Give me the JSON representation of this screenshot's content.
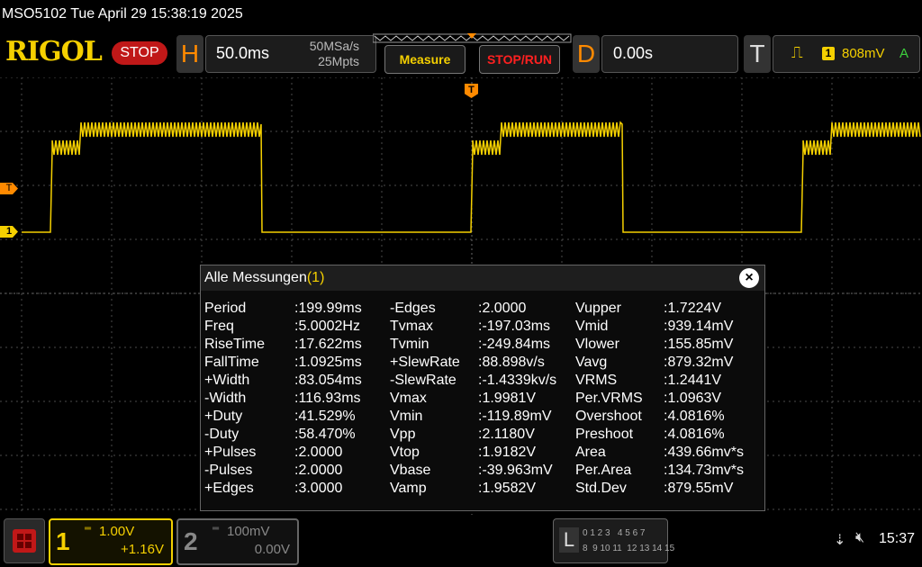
{
  "title": "MSO5102  Tue April 29 15:38:19 2025",
  "logo": "RIGOL",
  "run_state": "STOP",
  "horizontal": {
    "letter": "H",
    "timebase": "50.0ms",
    "sample_rate": "50MSa/s",
    "memory": "25Mpts"
  },
  "buttons": {
    "measure": "Measure",
    "stop_run": "STOP/RUN"
  },
  "delay": {
    "letter": "D",
    "value": "0.00s"
  },
  "trigger": {
    "letter": "T",
    "source": "1",
    "level": "808mV",
    "mode": "A"
  },
  "markers": {
    "trigger": "T",
    "ch1": "1",
    "top_trigger": "T"
  },
  "dialog": {
    "title": "Alle Messungen",
    "count": "(1)",
    "col1": [
      {
        "name": "Period",
        "value": ":199.99ms"
      },
      {
        "name": "Freq",
        "value": ":5.0002Hz"
      },
      {
        "name": "RiseTime",
        "value": ":17.622ms"
      },
      {
        "name": "FallTime",
        "value": ":1.0925ms"
      },
      {
        "name": "+Width",
        "value": ":83.054ms"
      },
      {
        "name": "-Width",
        "value": ":116.93ms"
      },
      {
        "name": "+Duty",
        "value": ":41.529%"
      },
      {
        "name": "-Duty",
        "value": ":58.470%"
      },
      {
        "name": "+Pulses",
        "value": ":2.0000"
      },
      {
        "name": "-Pulses",
        "value": ":2.0000"
      },
      {
        "name": "+Edges",
        "value": ":3.0000"
      }
    ],
    "col2": [
      {
        "name": "-Edges",
        "value": ":2.0000"
      },
      {
        "name": "Tvmax",
        "value": ":-197.03ms"
      },
      {
        "name": "Tvmin",
        "value": ":-249.84ms"
      },
      {
        "name": "+SlewRate",
        "value": ":88.898v/s"
      },
      {
        "name": "-SlewRate",
        "value": ":-1.4339kv/s"
      },
      {
        "name": "Vmax",
        "value": ":1.9981V"
      },
      {
        "name": "Vmin",
        "value": ":-119.89mV"
      },
      {
        "name": "Vpp",
        "value": ":2.1180V"
      },
      {
        "name": "Vtop",
        "value": ":1.9182V"
      },
      {
        "name": "Vbase",
        "value": ":-39.963mV"
      },
      {
        "name": "Vamp",
        "value": ":1.9582V"
      }
    ],
    "col3": [
      {
        "name": "Vupper",
        "value": ":1.7224V"
      },
      {
        "name": "Vmid",
        "value": ":939.14mV"
      },
      {
        "name": "Vlower",
        "value": ":155.85mV"
      },
      {
        "name": "Vavg",
        "value": ":879.32mV"
      },
      {
        "name": "VRMS",
        "value": ":1.2441V"
      },
      {
        "name": "Per.VRMS",
        "value": ":1.0963V"
      },
      {
        "name": "Overshoot",
        "value": ":4.0816%"
      },
      {
        "name": "Preshoot",
        "value": ":4.0816%"
      },
      {
        "name": "Area",
        "value": ":439.66mv*s"
      },
      {
        "name": "Per.Area",
        "value": ":134.73mv*s"
      },
      {
        "name": "Std.Dev",
        "value": ":879.55mV"
      }
    ]
  },
  "ch1": {
    "number": "1",
    "scale": "1.00V",
    "offset": "+1.16V"
  },
  "ch2": {
    "number": "2",
    "scale": "100mV",
    "offset": "0.00V"
  },
  "digital": {
    "letter": "L",
    "row1": "0 1 2 3   4 5 6 7",
    "row2": "8  9 10 11  12 13 14 15"
  },
  "status": {
    "time": "15:37"
  },
  "colors": {
    "ch1": "#f5d000",
    "accent": "#ff8a00",
    "stop": "#c01818"
  }
}
